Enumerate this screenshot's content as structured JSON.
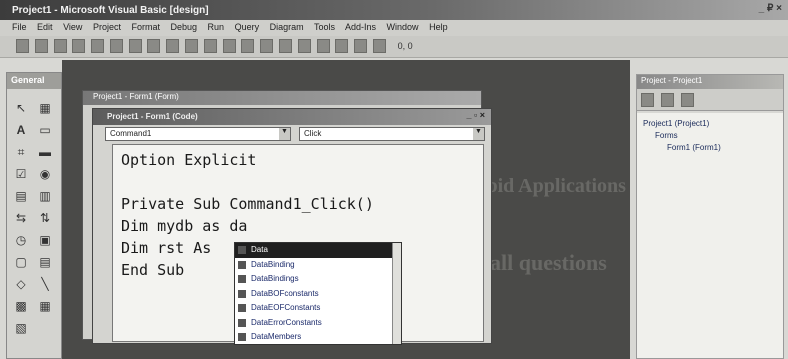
{
  "window": {
    "title": "Project1 - Microsoft Visual Basic [design]",
    "controls": "_ ₽ ×"
  },
  "menu": [
    "File",
    "Edit",
    "View",
    "Project",
    "Format",
    "Debug",
    "Run",
    "Query",
    "Diagram",
    "Tools",
    "Add-Ins",
    "Window",
    "Help"
  ],
  "toolbar": {
    "coords": "0, 0"
  },
  "toolbox": {
    "title": "General"
  },
  "form_window": {
    "title": "Project1 - Form1 (Form)"
  },
  "code_window": {
    "title": "Project1 - Form1 (Code)",
    "object_combo": "Command1",
    "proc_combo": "Click",
    "lines": [
      "Option Explicit",
      "",
      "Private Sub Command1_Click()",
      "Dim mydb as da",
      "Dim rst As",
      "End Sub"
    ]
  },
  "autocomplete": {
    "items": [
      "Data",
      "DataBinding",
      "DataBindings",
      "DataBOFconstants",
      "DataEOFConstants",
      "DataErrorConstants",
      "DataMembers"
    ],
    "selected_index": 0
  },
  "project_explorer": {
    "title": "Project - Project1",
    "tree": [
      "Project1 (Project1)",
      "Forms",
      "Form1 (Form1)"
    ]
  },
  "background_text": {
    "heading": "Rapid Applications",
    "sub": "all questions"
  }
}
